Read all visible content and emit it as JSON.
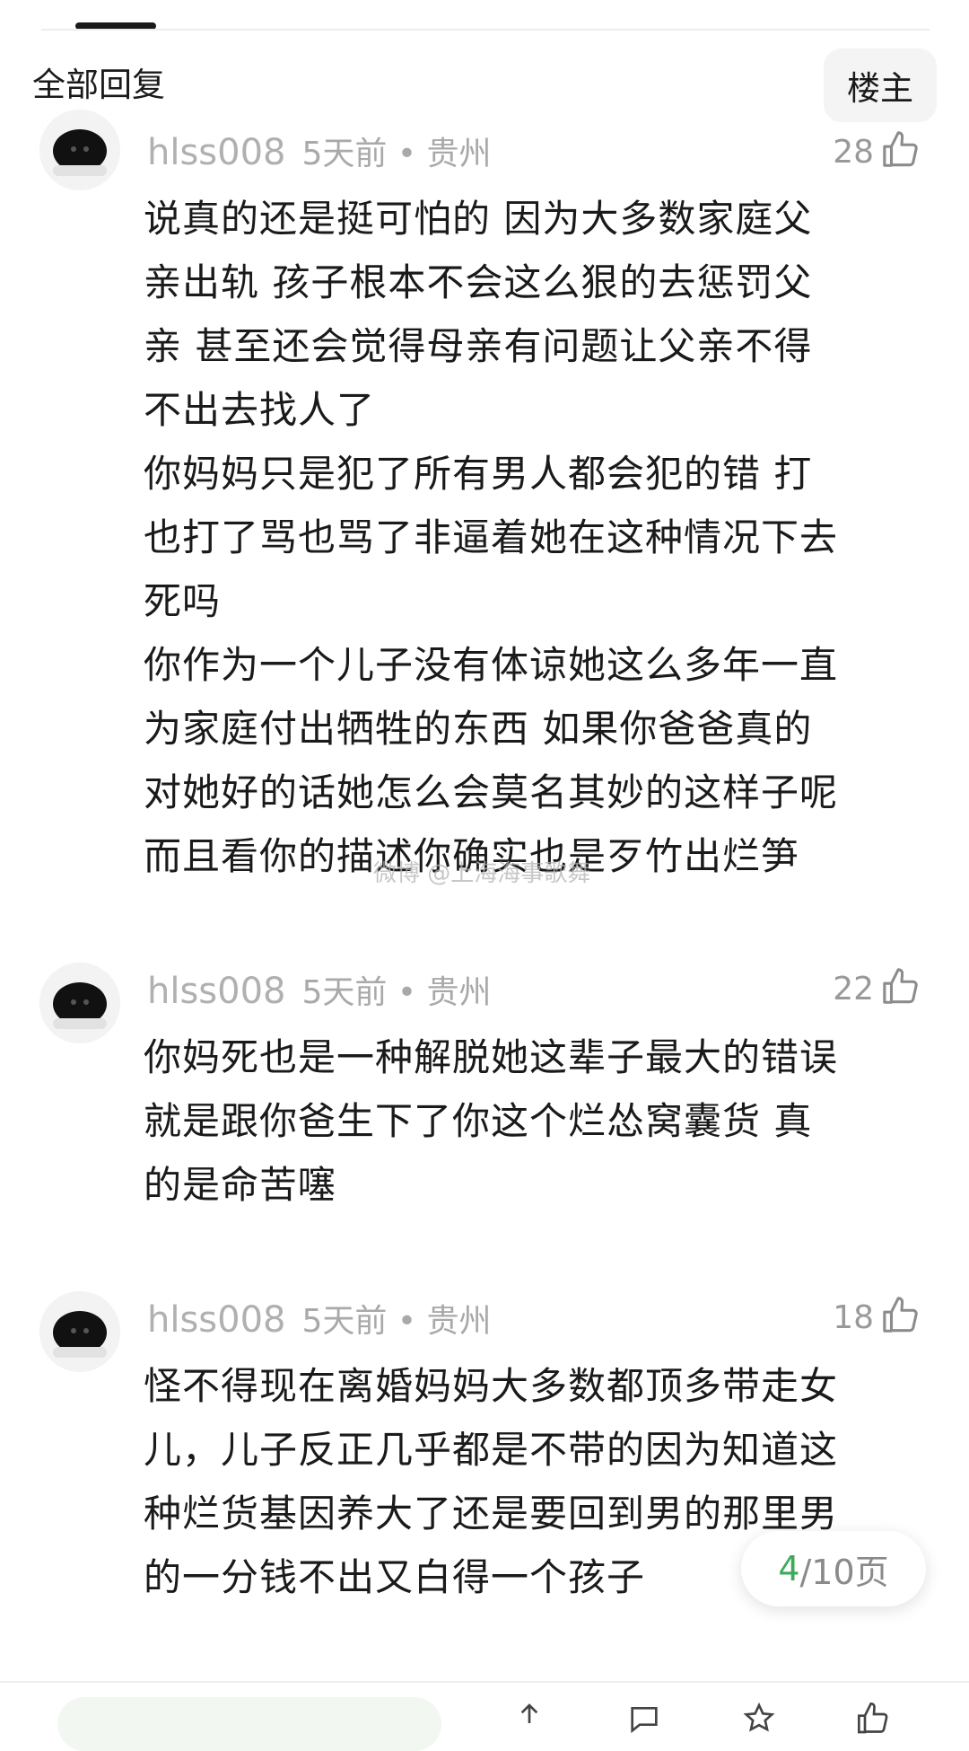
{
  "header": {
    "tab_label": "全部回复",
    "op_button_label": "楼主"
  },
  "comments": [
    {
      "username": "hlss008",
      "time_location": "5天前 • 贵州",
      "likes": "28",
      "text": "说真的还是挺可怕的 因为大多数家庭父\n亲出轨 孩子根本不会这么狠的去惩罚父\n亲  甚至还会觉得母亲有问题让父亲不得\n不出去找人了\n你妈妈只是犯了所有男人都会犯的错 打\n也打了骂也骂了非逼着她在这种情况下去\n死吗\n你作为一个儿子没有体谅她这么多年一直\n为家庭付出牺牲的东西 如果你爸爸真的\n对她好的话她怎么会莫名其妙的这样子呢\n而且看你的描述你确实也是歹竹出烂笋"
    },
    {
      "username": "hlss008",
      "time_location": "5天前 • 贵州",
      "likes": "22",
      "text": "你妈死也是一种解脱她这辈子最大的错误\n就是跟你爸生下了你这个烂怂窝囊货 真\n的是命苦噻"
    },
    {
      "username": "hlss008",
      "time_location": "5天前 • 贵州",
      "likes": "18",
      "text": "怪不得现在离婚妈妈大多数都顶多带走女\n儿，儿子反正几乎都是不带的因为知道这\n种烂货基因养大了还是要回到男的那里男\n的一分钱不出又白得一个孩子"
    }
  ],
  "watermark": "微博 @上海海事歌舞",
  "pagination": {
    "current": "4",
    "rest": "/10页"
  },
  "colors": {
    "accent_green": "#3daa5a",
    "meta_gray": "#a9a9a9",
    "text": "#1a1a1a"
  }
}
